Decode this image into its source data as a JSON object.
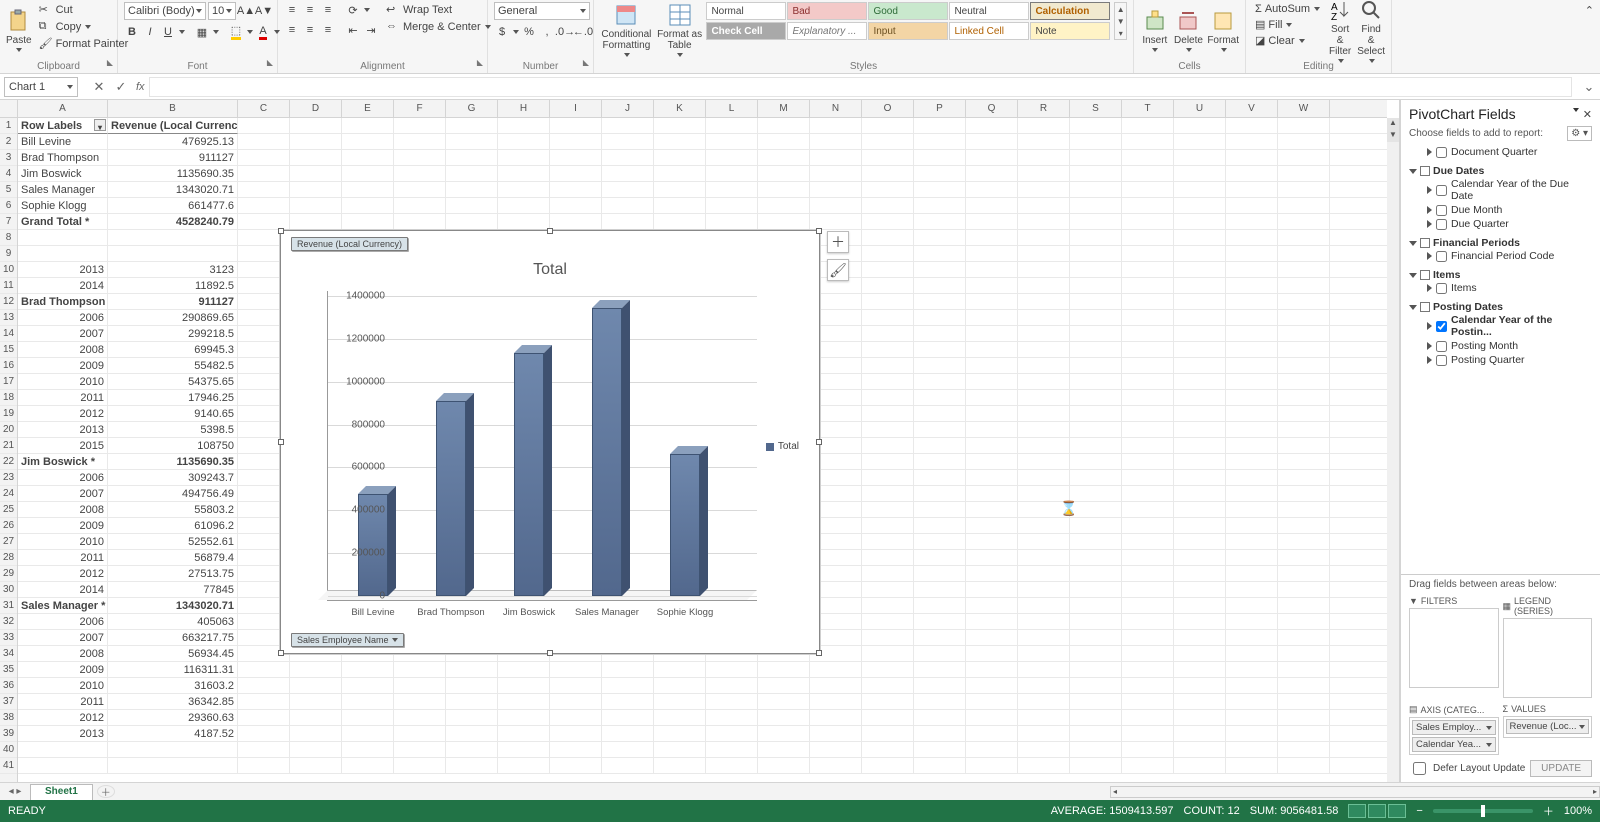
{
  "ribbon": {
    "clipboard": {
      "label": "Clipboard",
      "paste": "Paste",
      "cut": "Cut",
      "copy": "Copy",
      "painter": "Format Painter"
    },
    "font": {
      "label": "Font",
      "name": "Calibri (Body)",
      "size": "10"
    },
    "alignment": {
      "label": "Alignment",
      "wrap": "Wrap Text",
      "merge": "Merge & Center"
    },
    "number": {
      "label": "Number",
      "format": "General"
    },
    "styles": {
      "label": "Styles",
      "cond": "Conditional Formatting",
      "asTable": "Format as Table",
      "r1": [
        "Normal",
        "Bad",
        "Good",
        "Neutral",
        "Calculation"
      ],
      "r2": [
        "Check Cell",
        "Explanatory ...",
        "Input",
        "Linked Cell",
        "Note"
      ]
    },
    "cells": {
      "label": "Cells",
      "insert": "Insert",
      "delete": "Delete",
      "format": "Format"
    },
    "editing": {
      "label": "Editing",
      "autosum": "AutoSum",
      "fill": "Fill",
      "clear": "Clear",
      "sort": "Sort & Filter",
      "find": "Find & Select"
    }
  },
  "formula_bar": {
    "name": "Chart 1",
    "fx": "fx"
  },
  "columns": [
    "A",
    "B",
    "C",
    "D",
    "E",
    "F",
    "G",
    "H",
    "I",
    "J",
    "K",
    "L",
    "M",
    "N",
    "O",
    "P",
    "Q",
    "R",
    "S",
    "T",
    "U",
    "V",
    "W"
  ],
  "rows": [
    {
      "n": 1,
      "a": "Row Labels",
      "b": "Revenue (Local Currency)",
      "bold": true,
      "hdr": true
    },
    {
      "n": 2,
      "a": "Bill Levine",
      "b": "476925.13"
    },
    {
      "n": 3,
      "a": "Brad Thompson",
      "b": "911127"
    },
    {
      "n": 4,
      "a": "Jim Boswick",
      "b": "1135690.35"
    },
    {
      "n": 5,
      "a": "Sales Manager",
      "b": "1343020.71"
    },
    {
      "n": 6,
      "a": "Sophie Klogg",
      "b": "661477.6"
    },
    {
      "n": 7,
      "a": "Grand Total *",
      "b": "4528240.79",
      "bold": true
    },
    {
      "n": 8,
      "a": "",
      "b": ""
    },
    {
      "n": 9,
      "a": "",
      "b": ""
    },
    {
      "n": 10,
      "a": "2013",
      "b": "3123",
      "right": true
    },
    {
      "n": 11,
      "a": "2014",
      "b": "11892.5",
      "right": true
    },
    {
      "n": 12,
      "a": "Brad Thompson *",
      "b": "911127",
      "bold": true
    },
    {
      "n": 13,
      "a": "2006",
      "b": "290869.65",
      "right": true
    },
    {
      "n": 14,
      "a": "2007",
      "b": "299218.5",
      "right": true
    },
    {
      "n": 15,
      "a": "2008",
      "b": "69945.3",
      "right": true
    },
    {
      "n": 16,
      "a": "2009",
      "b": "55482.5",
      "right": true
    },
    {
      "n": 17,
      "a": "2010",
      "b": "54375.65",
      "right": true
    },
    {
      "n": 18,
      "a": "2011",
      "b": "17946.25",
      "right": true
    },
    {
      "n": 19,
      "a": "2012",
      "b": "9140.65",
      "right": true
    },
    {
      "n": 20,
      "a": "2013",
      "b": "5398.5",
      "right": true
    },
    {
      "n": 21,
      "a": "2015",
      "b": "108750",
      "right": true
    },
    {
      "n": 22,
      "a": "Jim Boswick *",
      "b": "1135690.35",
      "bold": true
    },
    {
      "n": 23,
      "a": "2006",
      "b": "309243.7",
      "right": true
    },
    {
      "n": 24,
      "a": "2007",
      "b": "494756.49",
      "right": true
    },
    {
      "n": 25,
      "a": "2008",
      "b": "55803.2",
      "right": true
    },
    {
      "n": 26,
      "a": "2009",
      "b": "61096.2",
      "right": true
    },
    {
      "n": 27,
      "a": "2010",
      "b": "52552.61",
      "right": true
    },
    {
      "n": 28,
      "a": "2011",
      "b": "56879.4",
      "right": true
    },
    {
      "n": 29,
      "a": "2012",
      "b": "27513.75",
      "right": true
    },
    {
      "n": 30,
      "a": "2014",
      "b": "77845",
      "right": true
    },
    {
      "n": 31,
      "a": "Sales Manager *",
      "b": "1343020.71",
      "bold": true
    },
    {
      "n": 32,
      "a": "2006",
      "b": "405063",
      "right": true
    },
    {
      "n": 33,
      "a": "2007",
      "b": "663217.75",
      "right": true
    },
    {
      "n": 34,
      "a": "2008",
      "b": "56934.45",
      "right": true
    },
    {
      "n": 35,
      "a": "2009",
      "b": "116311.31",
      "right": true
    },
    {
      "n": 36,
      "a": "2010",
      "b": "31603.2",
      "right": true
    },
    {
      "n": 37,
      "a": "2011",
      "b": "36342.85",
      "right": true
    },
    {
      "n": 38,
      "a": "2012",
      "b": "29360.63",
      "right": true
    },
    {
      "n": 39,
      "a": "2013",
      "b": "4187.52",
      "right": true
    }
  ],
  "chart_data": {
    "type": "bar",
    "title": "Total",
    "filter_top": "Revenue (Local Currency)",
    "filter_bottom": "Sales Employee Name",
    "legend": "Total",
    "ylim": [
      0,
      1400000
    ],
    "yticks": [
      0,
      200000,
      400000,
      600000,
      800000,
      1000000,
      1200000,
      1400000
    ],
    "categories": [
      "Bill Levine",
      "Brad Thompson",
      "Jim Boswick",
      "Sales Manager",
      "Sophie Klogg"
    ],
    "values": [
      476925.13,
      911127,
      1135690.35,
      1343020.71,
      661477.6
    ]
  },
  "fieldpane": {
    "title": "PivotChart Fields",
    "sub": "Choose fields to add to report:",
    "groups": [
      {
        "name": "",
        "items": [
          {
            "label": "Document Quarter",
            "checked": false
          }
        ]
      },
      {
        "name": "Due Dates",
        "items": [
          {
            "label": "Calendar Year of the Due Date",
            "checked": false
          },
          {
            "label": "Due Month",
            "checked": false
          },
          {
            "label": "Due Quarter",
            "checked": false
          }
        ]
      },
      {
        "name": "Financial Periods",
        "items": [
          {
            "label": "Financial Period Code",
            "checked": false
          }
        ]
      },
      {
        "name": "Items",
        "items": [
          {
            "label": "Items",
            "checked": false
          }
        ]
      },
      {
        "name": "Posting Dates",
        "bold": true,
        "items": [
          {
            "label": "Calendar Year of the Postin...",
            "checked": true
          },
          {
            "label": "Posting Month",
            "checked": false
          },
          {
            "label": "Posting Quarter",
            "checked": false
          }
        ]
      }
    ],
    "drag_hint": "Drag fields between areas below:",
    "areas": {
      "filters": {
        "label": "FILTERS",
        "items": []
      },
      "legend": {
        "label": "LEGEND (SERIES)",
        "items": []
      },
      "axis": {
        "label": "AXIS (CATEG...",
        "items": [
          "Sales Employ...",
          "Calendar Yea..."
        ]
      },
      "values": {
        "label": "VALUES",
        "items": [
          "Revenue (Loc..."
        ]
      }
    },
    "defer": "Defer Layout Update",
    "update": "UPDATE"
  },
  "sheet_tab": "Sheet1",
  "status": {
    "ready": "READY",
    "avg": "AVERAGE: 1509413.597",
    "count": "COUNT: 12",
    "sum": "SUM: 9056481.58",
    "zoom": "100%"
  }
}
